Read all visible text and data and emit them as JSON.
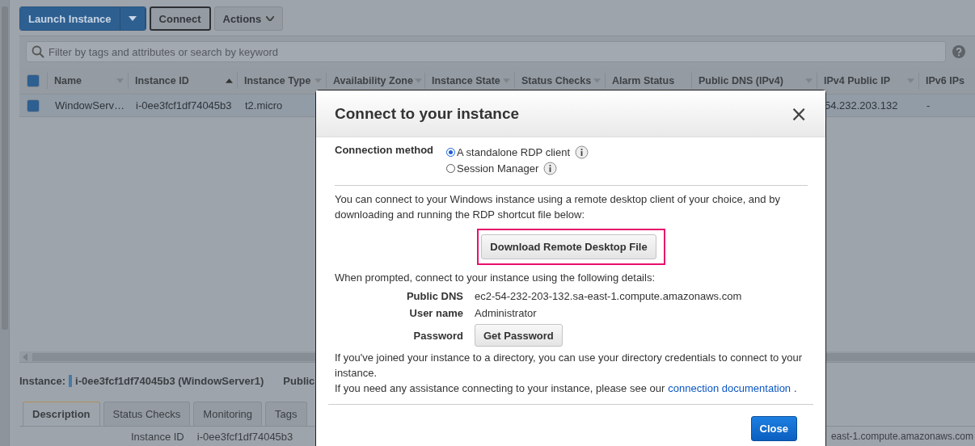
{
  "toolbar": {
    "launch_button": "Launch Instance",
    "connect_button": "Connect",
    "actions_button": "Actions"
  },
  "filter": {
    "placeholder": "Filter by tags and attributes or search by keyword"
  },
  "table": {
    "header_checked": true,
    "columns": [
      {
        "label": "Name",
        "kind": "menu"
      },
      {
        "label": "Instance ID",
        "kind": "sorted"
      },
      {
        "label": "Instance Type",
        "kind": "menu"
      },
      {
        "label": "Availability Zone",
        "kind": "menu"
      },
      {
        "label": "Instance State",
        "kind": "menu"
      },
      {
        "label": "Status Checks",
        "kind": "menu"
      },
      {
        "label": "Alarm Status",
        "kind": "plain"
      },
      {
        "label": "Public DNS (IPv4)",
        "kind": "menu"
      },
      {
        "label": "IPv4 Public IP",
        "kind": "menu"
      },
      {
        "label": "IPv6 IPs",
        "kind": "plain"
      }
    ],
    "rows": [
      {
        "selected": true,
        "checked": true,
        "cells": [
          "WindowServ…",
          "i-0ee3fcf1df74045b3",
          "t2.micro",
          "",
          "",
          "",
          "",
          "",
          "54.232.203.132",
          "-"
        ]
      }
    ]
  },
  "details": {
    "label": "Instance:",
    "value": "i-0ee3fcf1df74045b3 (WindowServer1)",
    "second_label": "Public",
    "tabs": [
      {
        "label": "Description",
        "selected": true
      },
      {
        "label": "Status Checks",
        "selected": false
      },
      {
        "label": "Monitoring",
        "selected": false
      },
      {
        "label": "Tags",
        "selected": false
      }
    ],
    "field_label": "Instance ID",
    "field_value": "i-0ee3fcf1df74045b3",
    "right_value": "east-1.compute.amazonaws.com"
  },
  "modal": {
    "title": "Connect to your instance",
    "close_glyph": "×",
    "method_label": "Connection method",
    "methods": [
      {
        "label": "A standalone RDP client",
        "selected": true
      },
      {
        "label": "Session Manager",
        "selected": false
      }
    ],
    "intro": "You can connect to your Windows instance using a remote desktop client of your choice, and by downloading and running the RDP shortcut file below:",
    "download_button": "Download Remote Desktop File",
    "prompt": "When prompted, connect to your instance using the following details:",
    "fields": [
      {
        "kind": "text",
        "label": "Public DNS",
        "value": "ec2-54-232-203-132.sa-east-1.compute.amazonaws.com"
      },
      {
        "kind": "text",
        "label": "User name",
        "value": "Administrator"
      },
      {
        "kind": "button",
        "label": "Password",
        "value": "Get Password"
      }
    ],
    "directory_note": "If you've joined your instance to a directory, you can use your directory credentials to connect to your instance.",
    "help_text": "If you need any assistance connecting to your instance, please see our",
    "help_link": "connection documentation",
    "help_end": ".",
    "close_button": "Close"
  }
}
